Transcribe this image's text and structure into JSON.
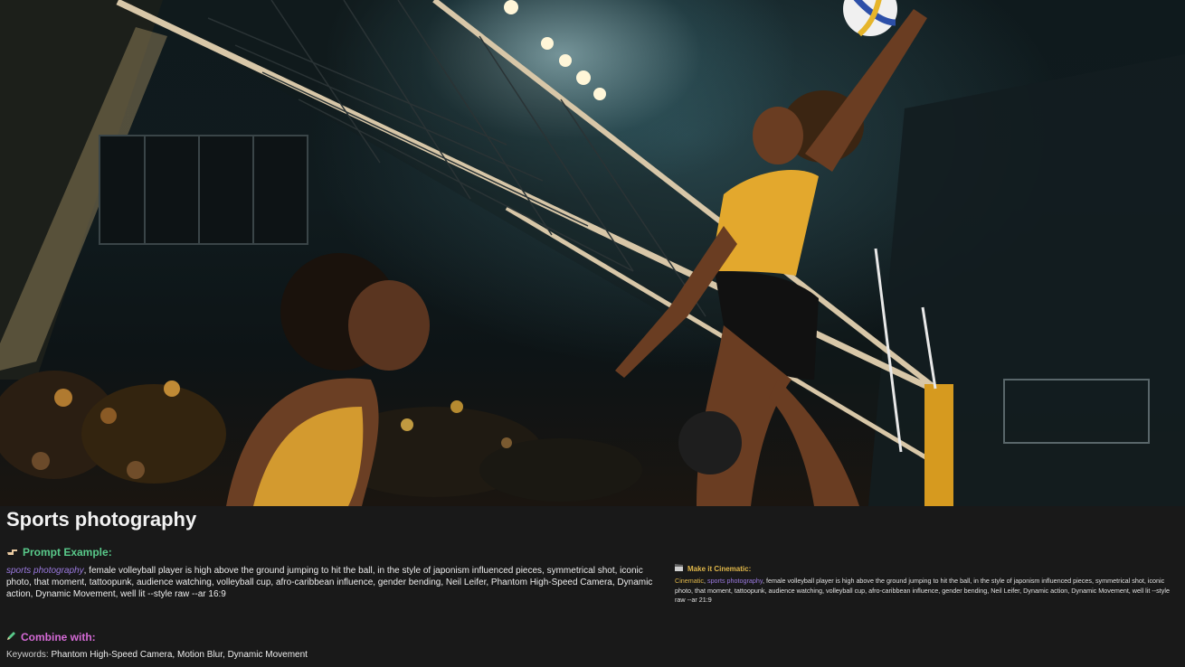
{
  "title": "Sports photography",
  "hero": {
    "caption": "Two volleyball players in an arena"
  },
  "prompt_example": {
    "icon": "hand-pointing-icon",
    "heading": "Prompt Example:",
    "style_tag": "sports photography",
    "text": ", female volleyball player is high above the ground jumping to hit the ball, in the style of japonism influenced pieces, symmetrical shot, iconic photo, that moment, tattoopunk, audience watching, volleyball cup, afro-caribbean influence, gender bending, Neil Leifer, Phantom High-Speed Camera, Dynamic action, Dynamic Movement, well lit --style raw --ar 16:9"
  },
  "cinematic": {
    "icon": "clapperboard-icon",
    "heading": "Make it Cinematic:",
    "cine_tag": "Cinematic",
    "sep": ", ",
    "style_tag": "sports photography",
    "text": ", female volleyball player is high above the ground jumping to hit the ball, in the style of japonism influenced pieces, symmetrical shot, iconic photo, that moment, tattoopunk, audience watching, volleyball cup, afro-caribbean influence, gender bending, Neil Leifer, Dynamic action, Dynamic Movement, well lit --style raw --ar 21:9"
  },
  "combine": {
    "icon": "pencil-icon",
    "heading": "Combine with:",
    "keywords_label": "Keywords:",
    "keywords": " Phantom High-Speed Camera, Motion Blur, Dynamic Movement"
  },
  "colors": {
    "green": "#59c98a",
    "magenta": "#d56ad6",
    "gold": "#e0b74a",
    "purple": "#9b7ae0",
    "background": "#191919"
  }
}
